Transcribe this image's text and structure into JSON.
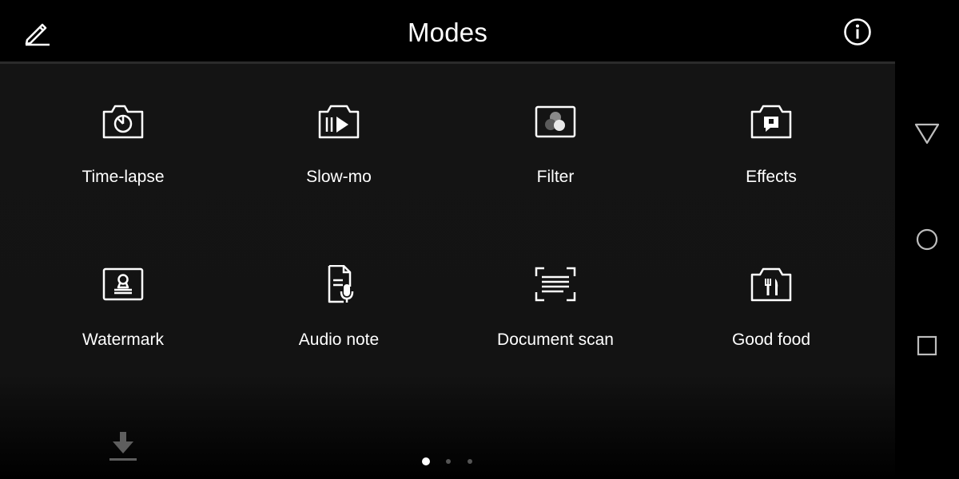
{
  "header": {
    "title": "Modes",
    "edit_icon": "pencil-icon",
    "info_icon": "info-icon"
  },
  "modes": [
    {
      "label": "Time-lapse",
      "icon": "time-lapse-icon"
    },
    {
      "label": "Slow-mo",
      "icon": "slow-mo-icon"
    },
    {
      "label": "Filter",
      "icon": "filter-icon"
    },
    {
      "label": "Effects",
      "icon": "effects-icon"
    },
    {
      "label": "Watermark",
      "icon": "watermark-icon"
    },
    {
      "label": "Audio note",
      "icon": "audio-note-icon"
    },
    {
      "label": "Document scan",
      "icon": "document-scan-icon"
    },
    {
      "label": "Good food",
      "icon": "good-food-icon"
    }
  ],
  "footer": {
    "download_icon": "download-icon",
    "page_count": 3,
    "current_page": 1
  },
  "navbar": {
    "back_icon": "triangle-back-icon",
    "home_icon": "circle-home-icon",
    "recents_icon": "square-recents-icon"
  },
  "colors": {
    "background": "#141414",
    "header": "#000000",
    "text": "#ffffff",
    "divider": "#2b2b2b",
    "muted": "#5a5a5a"
  }
}
